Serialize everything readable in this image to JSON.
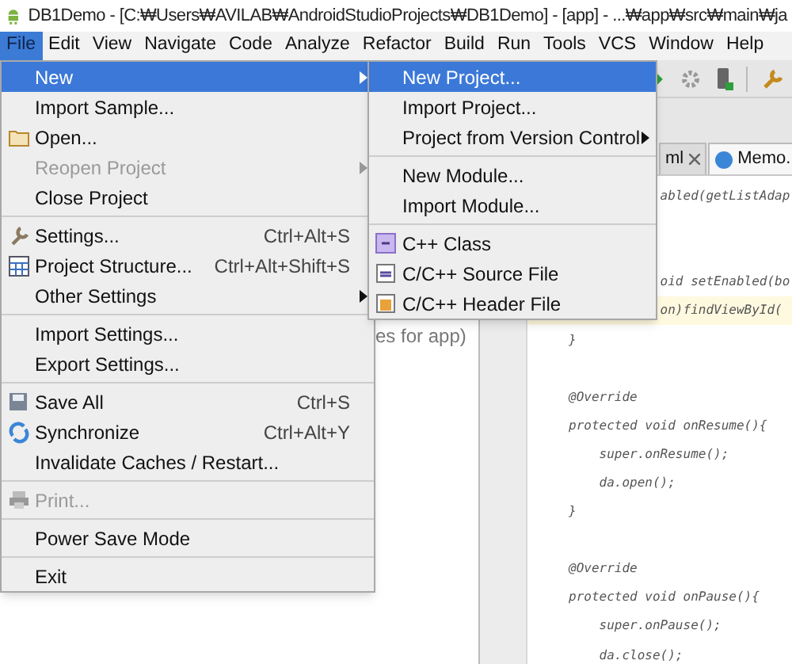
{
  "window": {
    "title": "DB1Demo - [C:₩Users₩AVILAB₩AndroidStudioProjects₩DB1Demo] - [app] - ...₩app₩src₩main₩ja"
  },
  "menu_bar": [
    {
      "label": "File",
      "selected": true
    },
    {
      "label": "Edit",
      "selected": false
    },
    {
      "label": "View",
      "selected": false
    },
    {
      "label": "Navigate",
      "selected": false
    },
    {
      "label": "Code",
      "selected": false
    },
    {
      "label": "Analyze",
      "selected": false
    },
    {
      "label": "Refactor",
      "selected": false
    },
    {
      "label": "Build",
      "selected": false
    },
    {
      "label": "Run",
      "selected": false
    },
    {
      "label": "Tools",
      "selected": false
    },
    {
      "label": "VCS",
      "selected": false
    },
    {
      "label": "Window",
      "selected": false
    },
    {
      "label": "Help",
      "selected": false
    }
  ],
  "file_menu": [
    [
      {
        "label": "New",
        "selected": true,
        "disabled": false,
        "submenu": true
      },
      {
        "label": "Import Sample...",
        "selected": false,
        "disabled": false,
        "submenu": false
      },
      {
        "label": "Open...",
        "selected": false,
        "disabled": false,
        "submenu": false
      },
      {
        "label": "Reopen Project",
        "selected": false,
        "disabled": true,
        "submenu": true
      },
      {
        "label": "Close Project",
        "selected": false,
        "disabled": false,
        "submenu": false
      }
    ],
    [
      {
        "label": "Settings...",
        "shortcut": "Ctrl+Alt+S",
        "selected": false,
        "disabled": false,
        "submenu": false
      },
      {
        "label": "Project Structure...",
        "shortcut": "Ctrl+Alt+Shift+S",
        "selected": false,
        "disabled": false,
        "submenu": false
      },
      {
        "label": "Other Settings",
        "selected": false,
        "disabled": false,
        "submenu": true
      }
    ],
    [
      {
        "label": "Import Settings...",
        "selected": false,
        "disabled": false,
        "submenu": false
      },
      {
        "label": "Export Settings...",
        "selected": false,
        "disabled": false,
        "submenu": false
      }
    ],
    [
      {
        "label": "Save All",
        "shortcut": "Ctrl+S",
        "selected": false,
        "disabled": false,
        "submenu": false
      },
      {
        "label": "Synchronize",
        "shortcut": "Ctrl+Alt+Y",
        "selected": false,
        "disabled": false,
        "submenu": false
      },
      {
        "label": "Invalidate Caches / Restart...",
        "selected": false,
        "disabled": false,
        "submenu": false
      }
    ],
    [
      {
        "label": "Print...",
        "selected": false,
        "disabled": true,
        "submenu": false
      }
    ],
    [
      {
        "label": "Power Save Mode",
        "selected": false,
        "disabled": false,
        "submenu": false
      }
    ],
    [
      {
        "label": "Exit",
        "selected": false,
        "disabled": false,
        "submenu": false
      }
    ]
  ],
  "new_submenu": [
    [
      {
        "label": "New Project...",
        "selected": true,
        "submenu": false
      },
      {
        "label": "Import Project...",
        "selected": false,
        "submenu": false
      },
      {
        "label": "Project from Version Control",
        "selected": false,
        "submenu": true
      }
    ],
    [
      {
        "label": "New Module...",
        "selected": false,
        "submenu": false
      },
      {
        "label": "Import Module...",
        "selected": false,
        "submenu": false
      }
    ],
    [
      {
        "label": "C++ Class",
        "selected": false,
        "submenu": false
      },
      {
        "label": "C/C++ Source File",
        "selected": false,
        "submenu": false
      },
      {
        "label": "C/C++ Header File",
        "selected": false,
        "submenu": false
      }
    ]
  ],
  "editor_tabs": [
    {
      "label": "ml",
      "selected": false,
      "closable": true
    },
    {
      "label": "Memo.",
      "selected": true,
      "closable": false
    }
  ],
  "project_panel": {
    "fragment": "es for app)"
  },
  "code_lines": [
    {
      "kind": "code",
      "text": "            abled(getListAdap",
      "highlighted": false
    },
    {
      "kind": "blank"
    },
    {
      "kind": "blank"
    },
    {
      "kind": "code",
      "text": "            oid setEnabled(bo",
      "highlighted": false
    },
    {
      "kind": "code",
      "text": "            on)findViewById(",
      "highlighted": true
    },
    {
      "kind": "code",
      "text": "}",
      "highlighted": false
    },
    {
      "kind": "blank"
    },
    {
      "kind": "code",
      "text": "@Override",
      "highlighted": false
    },
    {
      "kind": "code",
      "text": "protected void onResume(){",
      "highlighted": false
    },
    {
      "kind": "code",
      "text": "    super.onResume();",
      "highlighted": false
    },
    {
      "kind": "code",
      "text": "    da.open();",
      "highlighted": false
    },
    {
      "kind": "code",
      "text": "}",
      "highlighted": false
    },
    {
      "kind": "blank"
    },
    {
      "kind": "code",
      "text": "@Override",
      "highlighted": false
    },
    {
      "kind": "code",
      "text": "protected void onPause(){",
      "highlighted": false
    },
    {
      "kind": "code",
      "text": "    super.onPause();",
      "highlighted": false
    },
    {
      "kind": "code",
      "text": "    da.close();",
      "highlighted": false
    }
  ]
}
